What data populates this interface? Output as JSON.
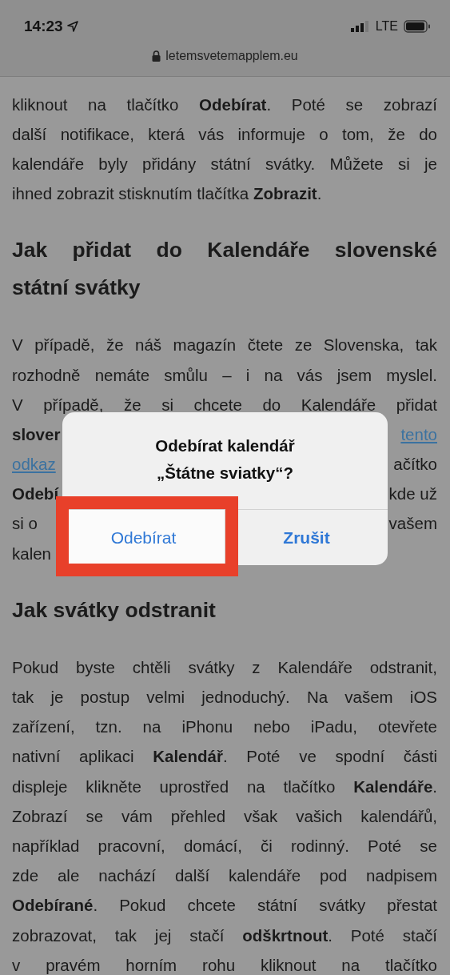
{
  "status_bar": {
    "time": "14:23",
    "network": "LTE"
  },
  "address_bar": {
    "url": "letemsvetemapplem.eu"
  },
  "article": {
    "blocks": [
      {
        "kind": "paragraph",
        "lines": [
          {
            "kind": "full",
            "segments": [
              {
                "kind": "text",
                "text": "kliknout na tlačítko **Odebírat**. Poté se zobrazí"
              }
            ]
          },
          {
            "kind": "full",
            "segments": [
              {
                "kind": "text",
                "text": "další notifikace, která vás informuje o tom, že do"
              }
            ]
          },
          {
            "kind": "full",
            "segments": [
              {
                "kind": "text",
                "text": "kalendáře byly přidány státní svátky. Můžete si je"
              }
            ]
          },
          {
            "kind": "full",
            "segments": [
              {
                "kind": "text",
                "text": "ihned zobrazit stisknutím tlačítka **Zobrazit**."
              }
            ]
          }
        ]
      },
      {
        "kind": "heading",
        "lines": [
          {
            "kind": "full",
            "segments": [
              {
                "kind": "text",
                "text": "Jak přidat do Kalendáře slovenské"
              }
            ]
          },
          {
            "kind": "full",
            "segments": [
              {
                "kind": "text",
                "text": "státní svátky"
              }
            ]
          }
        ]
      },
      {
        "kind": "paragraph",
        "lines": [
          {
            "kind": "full",
            "segments": [
              {
                "kind": "text",
                "text": "V případě, že náš magazín čtete ze Slovenska, tak"
              }
            ]
          },
          {
            "kind": "full",
            "segments": [
              {
                "kind": "text",
                "text": "rozhodně nemáte smůlu – i na vás jsem myslel."
              }
            ]
          },
          {
            "kind": "full",
            "segments": [
              {
                "kind": "text",
                "text": "V případě, že si chcete do Kalendáře přidat"
              }
            ]
          },
          {
            "kind": "split",
            "left": [
              {
                "kind": "text",
                "text": "**slover**"
              }
            ],
            "right": [
              {
                "kind": "link",
                "text": "tento"
              }
            ]
          },
          {
            "kind": "split",
            "left": [
              {
                "kind": "link",
                "text": "odkaz"
              }
            ],
            "right": [
              {
                "kind": "text",
                "text": "ačítko"
              }
            ]
          },
          {
            "kind": "split",
            "left": [
              {
                "kind": "text",
                "text": "**Odebí**"
              }
            ],
            "right": [
              {
                "kind": "text",
                "text": "kde už"
              }
            ]
          },
          {
            "kind": "split",
            "left": [
              {
                "kind": "text",
                "text": "si o"
              }
            ],
            "right": [
              {
                "kind": "text",
                "text": "vašem"
              }
            ]
          },
          {
            "kind": "split",
            "left": [
              {
                "kind": "text",
                "text": "kalen"
              }
            ]
          }
        ]
      },
      {
        "kind": "heading",
        "lines": [
          {
            "kind": "full",
            "segments": [
              {
                "kind": "text",
                "text": "Jak svátky odstranit"
              }
            ]
          }
        ]
      },
      {
        "kind": "paragraph",
        "lines": [
          {
            "kind": "full",
            "segments": [
              {
                "kind": "text",
                "text": "Pokud byste chtěli svátky z Kalendáře odstranit,"
              }
            ]
          },
          {
            "kind": "full",
            "segments": [
              {
                "kind": "text",
                "text": "tak je postup velmi jednoduchý. Na vašem iOS"
              }
            ]
          },
          {
            "kind": "full",
            "segments": [
              {
                "kind": "text",
                "text": "zařízení, tzn. na iPhonu nebo iPadu, otevřete"
              }
            ]
          },
          {
            "kind": "full",
            "segments": [
              {
                "kind": "text",
                "text": "nativní aplikaci **Kalendář**. Poté ve spodní části"
              }
            ]
          },
          {
            "kind": "full",
            "segments": [
              {
                "kind": "text",
                "text": "displeje klikněte uprostřed na tlačítko **Kalendáře**."
              }
            ]
          },
          {
            "kind": "full",
            "segments": [
              {
                "kind": "text",
                "text": "Zobrazí se vám přehled však vašich kalendářů,"
              }
            ]
          },
          {
            "kind": "full",
            "segments": [
              {
                "kind": "text",
                "text": "například pracovní, domácí, či rodinný. Poté se"
              }
            ]
          },
          {
            "kind": "full",
            "segments": [
              {
                "kind": "text",
                "text": "zde ale nachází další kalendáře pod nadpisem"
              }
            ]
          },
          {
            "kind": "full",
            "segments": [
              {
                "kind": "text",
                "text": "**Odebírané**. Pokud chcete státní svátky přestat"
              }
            ]
          },
          {
            "kind": "full",
            "segments": [
              {
                "kind": "text",
                "text": "zobrazovat, tak jej stačí **odškrtnout**. Poté stačí"
              }
            ]
          },
          {
            "kind": "full",
            "segments": [
              {
                "kind": "text",
                "text": "v pravém horním rohu kliknout na tlačítko"
              }
            ]
          }
        ]
      }
    ]
  },
  "dialog": {
    "title_lines": [
      "Odebírat kalendář",
      "„Štátne sviatky“?"
    ],
    "buttons": [
      {
        "label": "Odebírat",
        "highlighted": true,
        "bold": false
      },
      {
        "label": "Zrušit",
        "highlighted": false,
        "bold": true
      }
    ]
  }
}
